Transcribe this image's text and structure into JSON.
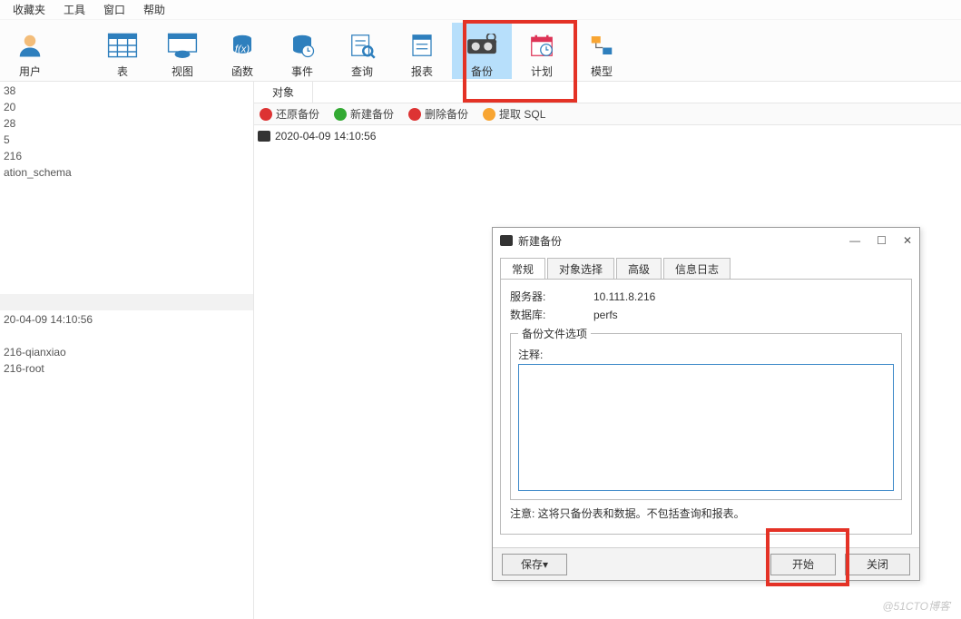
{
  "menus": {
    "m0": "收藏夹",
    "m1": "工具",
    "m2": "窗口",
    "m3": "帮助"
  },
  "ribbon": {
    "items": [
      {
        "label": "用户"
      },
      {
        "label": "表"
      },
      {
        "label": "视图"
      },
      {
        "label": "函数"
      },
      {
        "label": "事件"
      },
      {
        "label": "查询"
      },
      {
        "label": "报表"
      },
      {
        "label": "备份"
      },
      {
        "label": "计划"
      },
      {
        "label": "模型"
      }
    ]
  },
  "tree": {
    "items": [
      "38",
      "20",
      "28",
      "5",
      "216",
      "ation_schema",
      "",
      "",
      "",
      "",
      "",
      "",
      "",
      "",
      "20-04-09 14:10:56",
      "",
      "216-qianxiao",
      "216-root"
    ]
  },
  "tab": {
    "label": "对象"
  },
  "actions": {
    "restore": "还原备份",
    "create": "新建备份",
    "delete": "删除备份",
    "extract": "提取 SQL"
  },
  "objlist": {
    "item0": "2020-04-09 14:10:56"
  },
  "dialog": {
    "title": "新建备份",
    "tabs": {
      "t0": "常规",
      "t1": "对象选择",
      "t2": "高级",
      "t3": "信息日志"
    },
    "kv": {
      "server_k": "服务器:",
      "server_v": "10.111.8.216",
      "db_k": "数据库:",
      "db_v": "perfs"
    },
    "fieldset": {
      "legend": "备份文件选项",
      "note_label": "注释:",
      "note_value": ""
    },
    "hint": "注意: 这将只备份表和数据。不包括查询和报表。",
    "buttons": {
      "save": "保存",
      "start": "开始",
      "close": "关闭"
    }
  },
  "watermark": "@51CTO博客"
}
